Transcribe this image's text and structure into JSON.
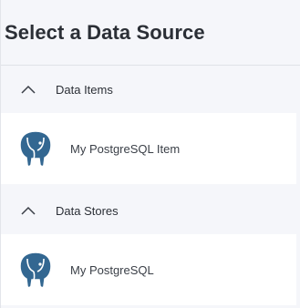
{
  "panel": {
    "title": "Select a Data Source"
  },
  "groups": [
    {
      "label": "Data Items",
      "expanded": true,
      "chevron_icon": "chevron-up-icon",
      "items": [
        {
          "label": "My PostgreSQL Item",
          "icon": "postgresql-elephant-icon"
        }
      ]
    },
    {
      "label": "Data Stores",
      "expanded": true,
      "chevron_icon": "chevron-up-icon",
      "items": [
        {
          "label": "My PostgreSQL",
          "icon": "postgresql-elephant-icon"
        }
      ]
    }
  ],
  "colors": {
    "background": "#f5f6fa",
    "item_background": "#ffffff",
    "postgres_blue": "#336791",
    "text": "#2b2f36"
  }
}
